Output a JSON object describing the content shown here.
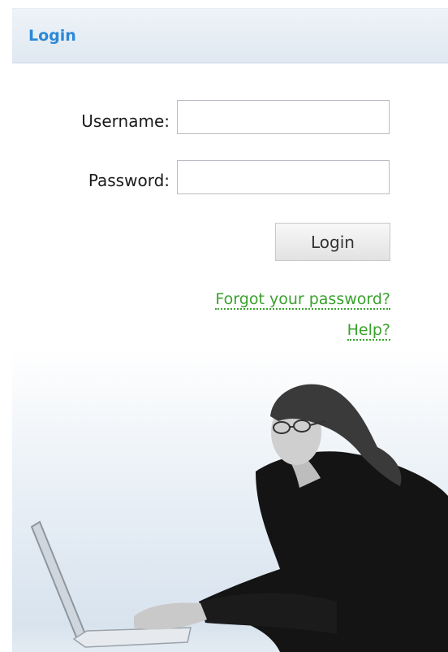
{
  "panel": {
    "title": "Login"
  },
  "form": {
    "username_label": "Username:",
    "username_value": "",
    "password_label": "Password:",
    "password_value": "",
    "submit_label": "Login"
  },
  "links": {
    "forgot_password": "Forgot your password?",
    "help": "Help?"
  },
  "colors": {
    "title": "#2a88d8",
    "link": "#3aa12e",
    "header_bg": "#e4ecf4"
  }
}
